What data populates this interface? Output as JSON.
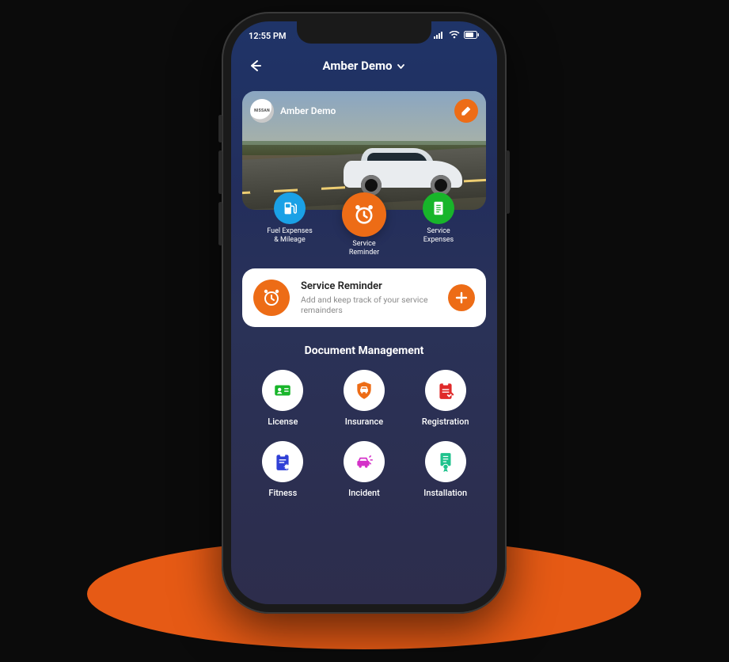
{
  "status": {
    "time": "12:55 PM"
  },
  "header": {
    "title": "Amber Demo"
  },
  "hero": {
    "brand_text": "NISSAN",
    "vehicle_name": "Amber Demo"
  },
  "tabs": [
    {
      "label": "Fuel Expenses\n& Mileage",
      "bg": "#1aa1e6",
      "icon": "fuel",
      "active": false
    },
    {
      "label": "Service\nReminder",
      "bg": "#ed6c16",
      "icon": "clock",
      "active": true
    },
    {
      "label": "Service\nExpenses",
      "bg": "#18b52a",
      "icon": "receipt",
      "active": false
    }
  ],
  "card": {
    "title": "Service Reminder",
    "subtitle": "Add and keep track of your service remainders"
  },
  "doc_section_title": "Document Management",
  "docs": [
    {
      "label": "License",
      "icon": "id-card",
      "color": "#18b52a"
    },
    {
      "label": "Insurance",
      "icon": "shield-car",
      "color": "#ed6c16"
    },
    {
      "label": "Registration",
      "icon": "clipboard-check",
      "color": "#e02a2a"
    },
    {
      "label": "Fitness",
      "icon": "clipboard-gear",
      "color": "#2f3fd6"
    },
    {
      "label": "Incident",
      "icon": "car-crash",
      "color": "#d431c8"
    },
    {
      "label": "Installation",
      "icon": "certificate",
      "color": "#1fc28c"
    }
  ]
}
